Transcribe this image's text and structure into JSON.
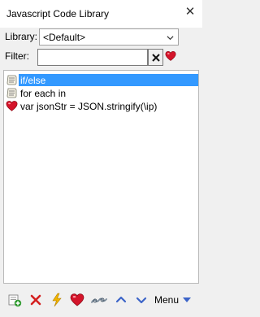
{
  "window": {
    "title": "Javascript Code Library"
  },
  "library": {
    "label": "Library:",
    "selected": "<Default>"
  },
  "filter": {
    "label": "Filter:",
    "value": "",
    "placeholder": ""
  },
  "snippets": [
    {
      "name": "if/else",
      "icon": "script-icon",
      "selected": true
    },
    {
      "name": "for each in",
      "icon": "script-icon",
      "selected": false
    },
    {
      "name": "var jsonStr = JSON.stringify(\\ip)",
      "icon": "heart-icon",
      "selected": false
    }
  ],
  "toolbar": {
    "buttons": [
      "add-icon",
      "delete-icon",
      "lightning-icon",
      "heart-icon",
      "link-icon",
      "up-icon",
      "down-icon"
    ],
    "menu_label": "Menu"
  },
  "colors": {
    "selection": "#3399ff",
    "accent_blue": "#3c64c8",
    "heart": "#d4142a",
    "delete": "#d42020",
    "lightning": "#f0b400",
    "add": "#2e9a2e"
  }
}
